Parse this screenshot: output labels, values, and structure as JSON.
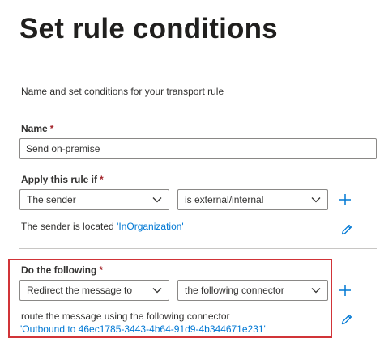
{
  "page": {
    "title": "Set rule conditions",
    "subtitle": "Name and set conditions for your transport rule"
  },
  "name_field": {
    "label": "Name",
    "required_mark": "*",
    "value": "Send on-premise"
  },
  "apply_rule": {
    "label": "Apply this rule if",
    "required_mark": "*",
    "condition_dropdown": "The sender",
    "operator_dropdown": "is external/internal",
    "summary_prefix": "The sender is located ",
    "summary_value": "'InOrganization'"
  },
  "do_following": {
    "label": "Do the following",
    "required_mark": "*",
    "action_dropdown": "Redirect the message to",
    "target_dropdown": "the following connector",
    "summary_text": "route the message using the following connector",
    "summary_value": "'Outbound to 46ec1785-3443-4b64-91d9-4b344671e231'"
  },
  "colors": {
    "accent": "#0078d4",
    "highlight": "#d13438",
    "required": "#a4262c"
  },
  "icons": {
    "add": "plus-icon",
    "edit": "pencil-icon",
    "dropdown": "chevron-down-icon"
  }
}
